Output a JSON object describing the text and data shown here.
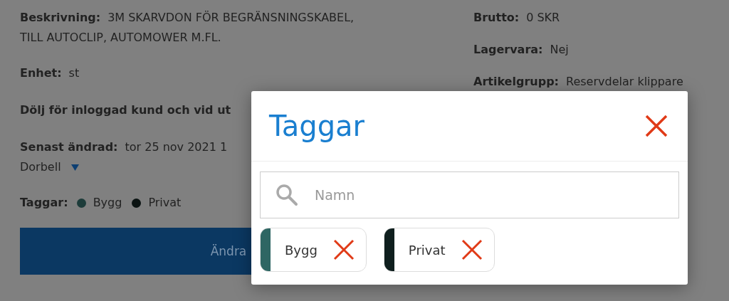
{
  "details_left": [
    {
      "label": "Beskrivning:",
      "value": "3M SKARVDON FÖR BEGRÄNSNINGSKABEL,",
      "continuation": "TILL AUTOCLIP, AUTOMOWER M.FL."
    },
    {
      "label": "Enhet:",
      "value": "st"
    },
    {
      "label": "Dölj för inloggad kund och vid ut"
    },
    {
      "label": "Senast ändrad:",
      "value": "tor 25 nov 2021 1",
      "continuation": "Dorbell"
    }
  ],
  "details_right": [
    {
      "label": "Brutto:",
      "value": "0 SKR"
    },
    {
      "label": "Lagervara:",
      "value": "Nej"
    },
    {
      "label": "Artikelgrupp:",
      "value": "Reservdelar klippare"
    }
  ],
  "tags_line": {
    "label": "Taggar:",
    "tags": [
      {
        "name": "Bygg",
        "color": "#1d3c3a"
      },
      {
        "name": "Privat",
        "color": "#0b1312"
      }
    ]
  },
  "edit_button": "Ändra",
  "modal": {
    "title": "Taggar",
    "search": {
      "placeholder": "Namn"
    },
    "chips": [
      {
        "name": "Bygg",
        "color": "#2e6663"
      },
      {
        "name": "Privat",
        "color": "#0f1f1e"
      }
    ]
  }
}
